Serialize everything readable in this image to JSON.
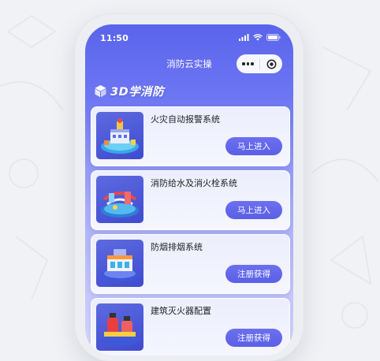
{
  "status_bar": {
    "time": "11:50"
  },
  "nav": {
    "title": "消防云实操"
  },
  "brand": {
    "text": "3D学消防"
  },
  "courses": [
    {
      "title": "火灾自动报警系统",
      "button": "马上进入"
    },
    {
      "title": "消防给水及消火栓系统",
      "button": "马上进入"
    },
    {
      "title": "防烟排烟系统",
      "button": "注册获得"
    },
    {
      "title": "建筑灭火器配置",
      "button": "注册获得"
    }
  ],
  "colors": {
    "accent": "#5a5fe6",
    "header_gradient_top": "#5a64ec",
    "background": "#f1f2f5"
  },
  "icons": [
    "signal-icon",
    "wifi-icon",
    "battery-icon",
    "more-icon",
    "target-icon",
    "cube-icon"
  ]
}
